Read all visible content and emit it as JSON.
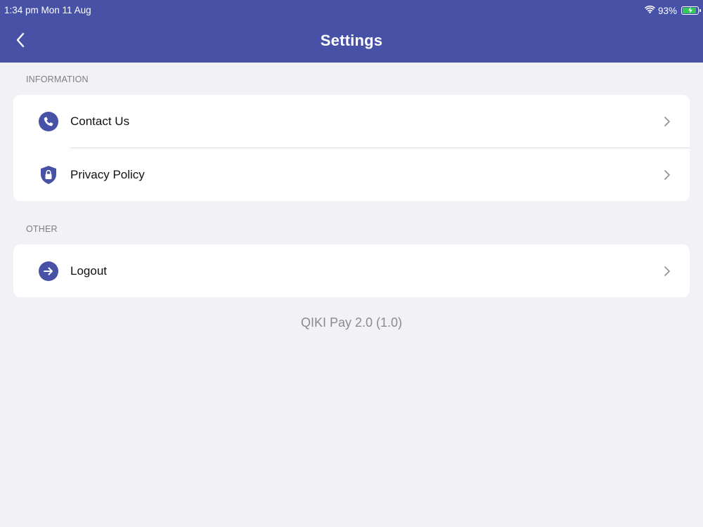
{
  "status_bar": {
    "time_date": "1:34 pm   Mon 11 Aug",
    "battery": "93%",
    "battery_level": 0.93,
    "wifi_icon": "wifi-icon",
    "battery_icon": "battery-charging-icon"
  },
  "header": {
    "title": "Settings",
    "back_icon": "chevron-left-icon",
    "background": "#4752a7"
  },
  "sections": {
    "information": {
      "label": "INFORMATION",
      "items": [
        {
          "label": "Contact Us",
          "icon": "phone-icon"
        },
        {
          "label": "Privacy Policy",
          "icon": "shield-lock-icon"
        }
      ]
    },
    "other": {
      "label": "OTHER",
      "items": [
        {
          "label": "Logout",
          "icon": "arrow-right-icon"
        }
      ]
    }
  },
  "footer": {
    "version": "QIKI Pay 2.0 (1.0)"
  },
  "colors": {
    "accent": "#4752a7",
    "background": "#f2f1f6",
    "battery_charging": "#34c759"
  }
}
